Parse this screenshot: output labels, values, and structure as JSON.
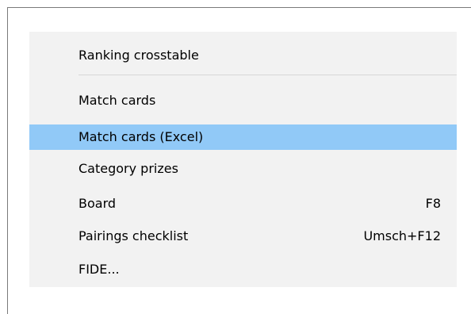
{
  "menu": {
    "items": [
      {
        "label": "Ranking crosstable",
        "shortcut": ""
      },
      {
        "label": "Match cards",
        "shortcut": ""
      },
      {
        "label": "Match cards (Excel)",
        "shortcut": "",
        "highlighted": true
      },
      {
        "label": "Category prizes",
        "shortcut": ""
      },
      {
        "label": "Board",
        "shortcut": "F8"
      },
      {
        "label": "Pairings checklist",
        "shortcut": "Umsch+F12"
      },
      {
        "label": "FIDE...",
        "shortcut": ""
      }
    ],
    "highlight_color": "#91c9f7",
    "background_color": "#f2f2f2"
  }
}
